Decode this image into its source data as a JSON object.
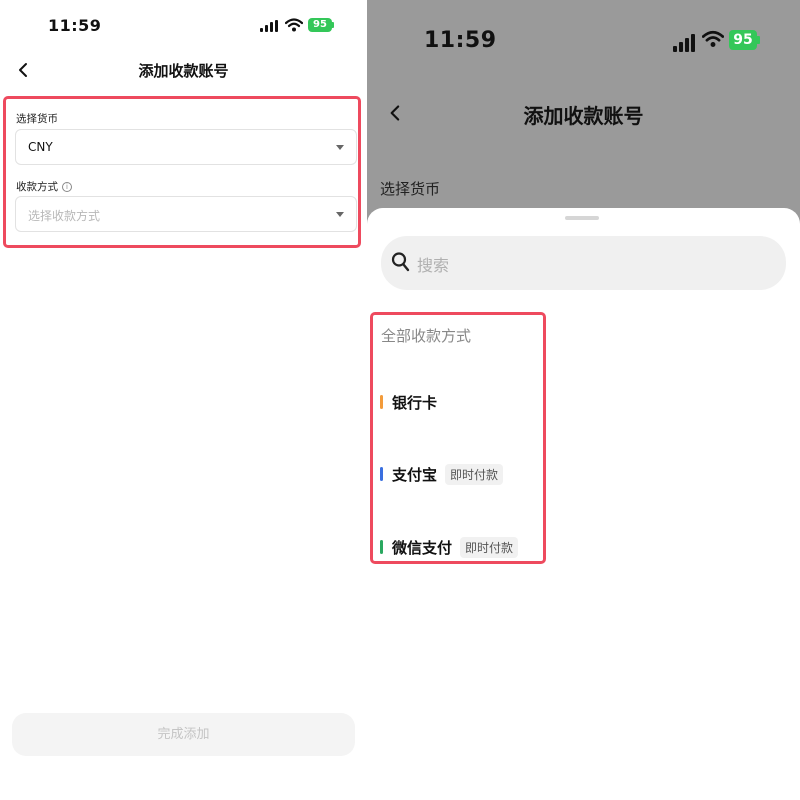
{
  "left": {
    "status_bar": {
      "time": "11:59",
      "battery": "95"
    },
    "header": {
      "title": "添加收款账号"
    },
    "currency": {
      "label": "选择货币",
      "value": "CNY"
    },
    "method": {
      "label": "收款方式",
      "placeholder": "选择收款方式"
    },
    "submit_label": "完成添加"
  },
  "right": {
    "status_bar": {
      "time": "11:59",
      "battery": "95"
    },
    "header": {
      "title": "添加收款账号"
    },
    "background_label": "选择货币",
    "sheet": {
      "search_placeholder": "搜索",
      "section_title": "全部收款方式",
      "methods": [
        {
          "name": "银行卡",
          "tag": "",
          "color": "#f39b3a"
        },
        {
          "name": "支付宝",
          "tag": "即时付款",
          "color": "#3a6fe0"
        },
        {
          "name": "微信支付",
          "tag": "即时付款",
          "color": "#2aa860"
        }
      ]
    }
  },
  "colors": {
    "highlight": "#ee4a5e",
    "battery": "#34c759"
  },
  "icons": [
    "back-icon",
    "signal-icon",
    "wifi-icon",
    "battery-icon",
    "chevron-down-icon",
    "info-icon",
    "search-icon"
  ]
}
